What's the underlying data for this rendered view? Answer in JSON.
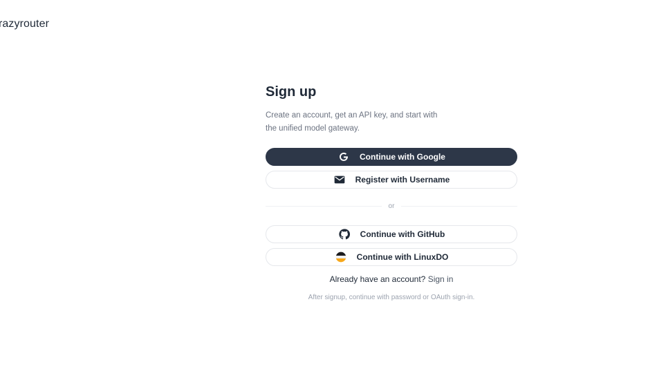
{
  "brand": {
    "name": "razyrouter"
  },
  "signup": {
    "title": "Sign up",
    "subtitle": "Create an account, get an API key, and start with the unified model gateway."
  },
  "buttons": {
    "google": {
      "label": "Continue with Google",
      "icon": "google-icon"
    },
    "username": {
      "label": "Register with Username",
      "icon": "mail-icon"
    },
    "github": {
      "label": "Continue with GitHub",
      "icon": "github-icon"
    },
    "linuxdo": {
      "label": "Continue with LinuxDO",
      "icon": "linuxdo-icon"
    }
  },
  "divider": {
    "text": "or"
  },
  "signin": {
    "prompt": "Already have an account?",
    "link": "Sign in"
  },
  "footer_note": "After signup, continue with password or OAuth sign-in.",
  "colors": {
    "primary": "#2d3748",
    "border": "#e5e7eb",
    "muted": "#6b7280",
    "linuxdo_top": "#1c1c1e",
    "linuxdo_mid": "#f0f0f0",
    "linuxdo_bottom": "#f7a81b"
  }
}
